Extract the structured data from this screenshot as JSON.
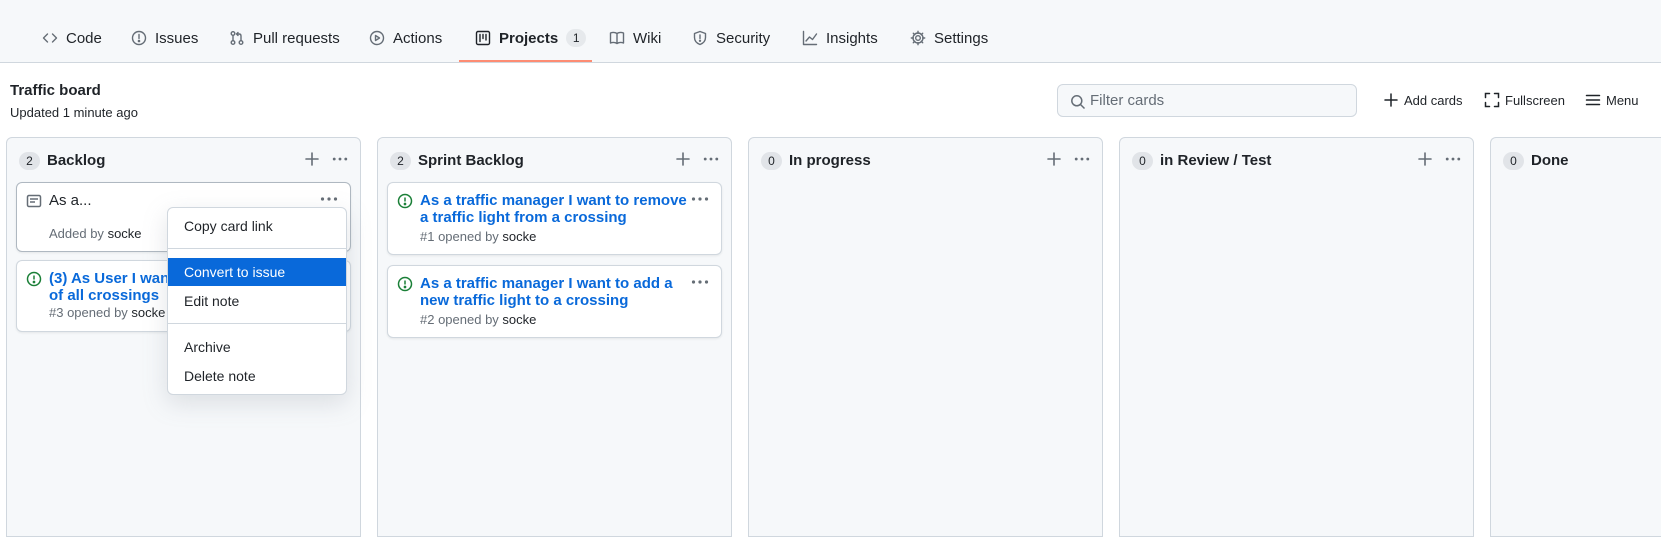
{
  "nav": {
    "tabs": [
      {
        "label": "Code",
        "icon": "code-icon"
      },
      {
        "label": "Issues",
        "icon": "issue-icon"
      },
      {
        "label": "Pull requests",
        "icon": "pull-request-icon"
      },
      {
        "label": "Actions",
        "icon": "play-icon"
      },
      {
        "label": "Projects",
        "icon": "project-icon",
        "counter": "1",
        "selected": true
      },
      {
        "label": "Wiki",
        "icon": "book-icon"
      },
      {
        "label": "Security",
        "icon": "shield-icon"
      },
      {
        "label": "Insights",
        "icon": "graph-icon"
      },
      {
        "label": "Settings",
        "icon": "gear-icon"
      }
    ],
    "selected_color": "#fd8c73"
  },
  "board": {
    "title": "Traffic board",
    "updated": "Updated 1 minute ago",
    "filter_placeholder": "Filter cards",
    "add_cards_label": "Add cards",
    "fullscreen_label": "Fullscreen",
    "menu_label": "Menu"
  },
  "columns": [
    {
      "name": "Backlog",
      "count": "2",
      "cards": [
        {
          "type": "note",
          "title": "As a...",
          "meta_prefix": "Added by",
          "meta_user": "socke"
        },
        {
          "type": "issue",
          "title": "(3) As User I want",
          "title_line2": "of all crossings",
          "meta_prefix": "#3 opened by",
          "meta_user": "socke"
        }
      ]
    },
    {
      "name": "Sprint Backlog",
      "count": "2",
      "cards": [
        {
          "type": "issue",
          "title": "As a traffic manager I want to remove a traffic light from a crossing",
          "meta_prefix": "#1 opened by",
          "meta_user": "socke"
        },
        {
          "type": "issue",
          "title": "As a traffic manager I want to add a new traffic light to a crossing",
          "meta_prefix": "#2 opened by",
          "meta_user": "socke"
        }
      ]
    },
    {
      "name": "In progress",
      "count": "0",
      "cards": []
    },
    {
      "name": "in Review / Test",
      "count": "0",
      "cards": []
    },
    {
      "name": "Done",
      "count": "0",
      "cards": []
    }
  ],
  "context_menu": {
    "items": [
      "Copy card link",
      "Convert to issue",
      "Edit note",
      "Archive",
      "Delete note"
    ],
    "active_item": "Convert to issue",
    "active_color": "#0969da"
  },
  "colors": {
    "link": "#0969da",
    "open_issue": "#1a7f37"
  }
}
